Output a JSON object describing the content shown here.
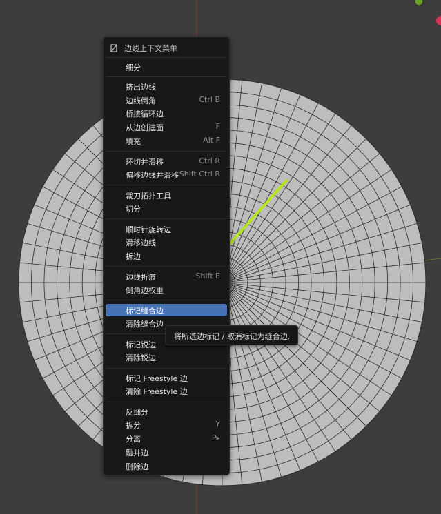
{
  "menu": {
    "title": "边线上下文菜单",
    "items": [
      {
        "label": "细分",
        "shortcut": ""
      },
      {
        "label": "挤出边线",
        "shortcut": ""
      },
      {
        "label": "边线倒角",
        "shortcut": "Ctrl B"
      },
      {
        "label": "桥接循环边",
        "shortcut": ""
      },
      {
        "label": "从边创建面",
        "shortcut": "F"
      },
      {
        "label": "填充",
        "shortcut": "Alt F"
      },
      {
        "label": "环切并滑移",
        "shortcut": "Ctrl R"
      },
      {
        "label": "偏移边线并滑移",
        "shortcut": "Shift Ctrl R"
      },
      {
        "label": "裁刀拓扑工具",
        "shortcut": ""
      },
      {
        "label": "切分",
        "shortcut": ""
      },
      {
        "label": "顺时针旋转边",
        "shortcut": ""
      },
      {
        "label": "滑移边线",
        "shortcut": ""
      },
      {
        "label": "拆边",
        "shortcut": ""
      },
      {
        "label": "边线折痕",
        "shortcut": "Shift E"
      },
      {
        "label": "倒角边权重",
        "shortcut": ""
      },
      {
        "label": "标记缝合边",
        "shortcut": ""
      },
      {
        "label": "清除缝合边",
        "shortcut": ""
      },
      {
        "label": "标记锐边",
        "shortcut": ""
      },
      {
        "label": "清除锐边",
        "shortcut": ""
      },
      {
        "label": "标记 Freestyle 边",
        "shortcut": ""
      },
      {
        "label": "清除 Freestyle 边",
        "shortcut": ""
      },
      {
        "label": "反细分",
        "shortcut": ""
      },
      {
        "label": "拆分",
        "shortcut": "Y"
      },
      {
        "label": "分离",
        "shortcut": "P▸"
      },
      {
        "label": "融并边",
        "shortcut": ""
      },
      {
        "label": "删除边",
        "shortcut": ""
      }
    ],
    "active_label": "标记缝合边"
  },
  "tooltip": {
    "text": "将所选边标记 / 取消标记为缝合边."
  },
  "colors": {
    "accent": "#4772b3",
    "arrow": "#b4e61e",
    "background": "#3d3d3d",
    "mesh_fill": "#bdbdbd",
    "mesh_line": "#2a2a2a",
    "axis_red": "#c43a3a",
    "axis_green": "#6aa02a"
  },
  "icons": {
    "menu": "edge-select-mode-icon",
    "annotation": "green-arrow-icon"
  }
}
